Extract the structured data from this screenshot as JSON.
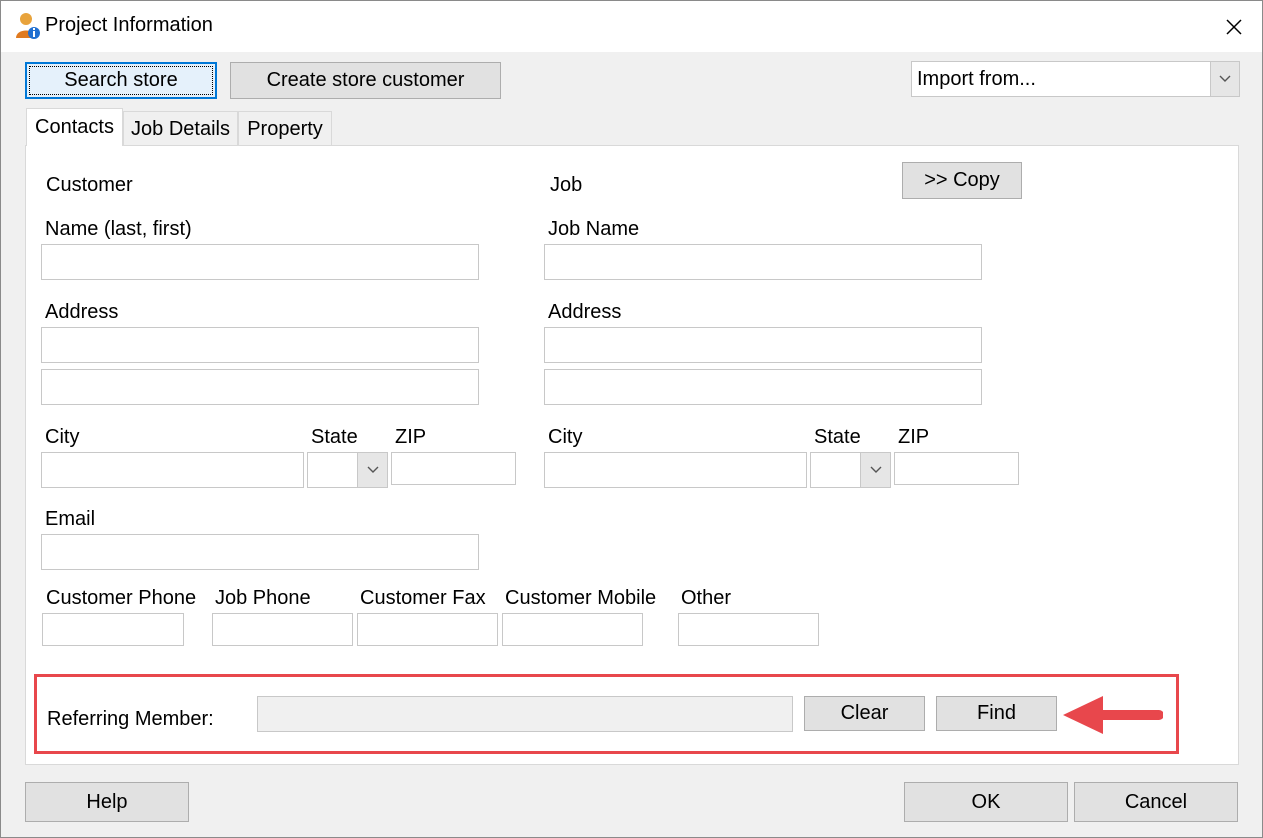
{
  "window": {
    "title": "Project Information"
  },
  "toolbar": {
    "search_store": "Search store",
    "create_store_customer": "Create store customer",
    "import_from": "Import from..."
  },
  "tabs": [
    {
      "label": "Contacts",
      "active": true
    },
    {
      "label": "Job Details",
      "active": false
    },
    {
      "label": "Property",
      "active": false
    }
  ],
  "contacts": {
    "customer_heading": "Customer",
    "job_heading": "Job",
    "copy_button": ">> Copy",
    "customer": {
      "name_label": "Name (last, first)",
      "name_value": "",
      "address_label": "Address",
      "address1": "",
      "address2": "",
      "city_label": "City",
      "state_label": "State",
      "zip_label": "ZIP",
      "email_label": "Email"
    },
    "job": {
      "name_label": "Job Name",
      "name_value": "",
      "address_label": "Address",
      "address1": "",
      "address2": "",
      "city_label": "City",
      "state_label": "State",
      "zip_label": "ZIP"
    },
    "phones": {
      "customer_phone": "Customer Phone",
      "job_phone": "Job Phone",
      "customer_fax": "Customer Fax",
      "customer_mobile": "Customer Mobile",
      "other": "Other"
    },
    "referring": {
      "label": "Referring Member:",
      "value": "",
      "clear": "Clear",
      "find": "Find"
    }
  },
  "footer": {
    "help": "Help",
    "ok": "OK",
    "cancel": "Cancel"
  },
  "colors": {
    "annotation": "#e8474c",
    "focus_border": "#0078d7"
  }
}
